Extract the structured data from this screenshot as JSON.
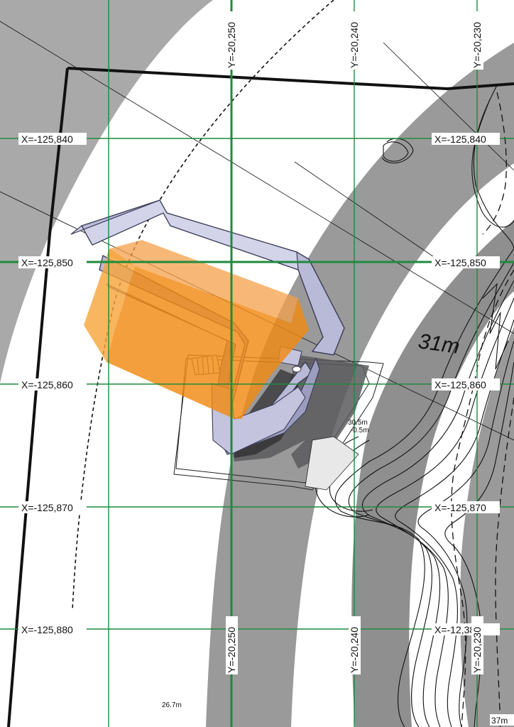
{
  "map": {
    "grid_x_labels": [
      "X=-125,840",
      "X=-125,850",
      "X=-125,860",
      "X=-125,870",
      "X=-125,880"
    ],
    "grid_x_labels_right": [
      "X=-125,840",
      "X=-125,850",
      "X=-125,860",
      "X=-125,870",
      "X=-12,380"
    ],
    "grid_y_labels_top": [
      "Y=-20,250",
      "Y=-20,240",
      "Y=-20,230"
    ],
    "grid_y_labels_bottom": [
      "Y=-20,250",
      "Y=-20,240",
      "Y=-20,230"
    ],
    "contour_label": "31m",
    "depth_label_1": "30.5m",
    "depth_label_2": "-0.5m",
    "bottom_label": "26.7m",
    "corner_label": "37m",
    "colors": {
      "grid": "#1f8a3c",
      "ring": "#9a9a9a",
      "ring_dark": "#8a8a8a",
      "structure": "#b8b8d6",
      "structure_dark": "#4a4a6a",
      "highlight": "#f28a12",
      "contour": "#111111"
    }
  }
}
